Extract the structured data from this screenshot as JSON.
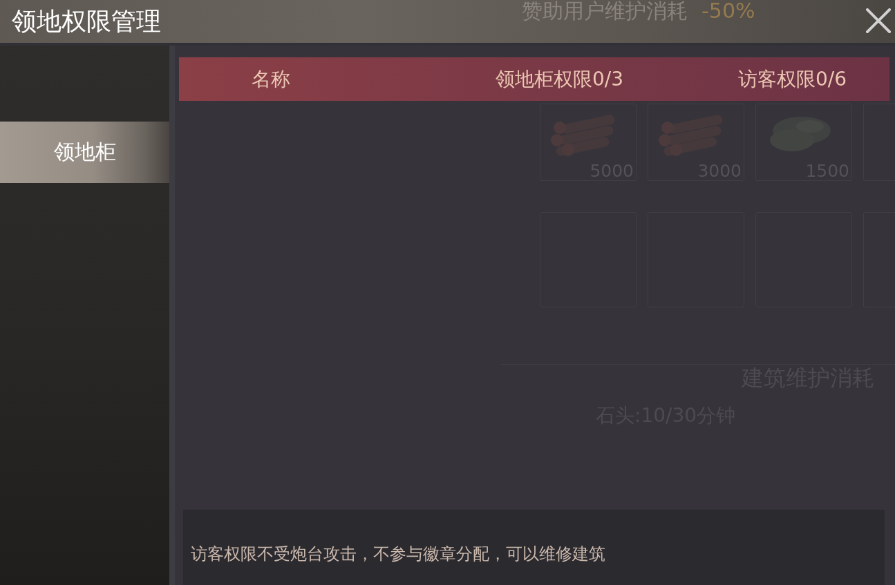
{
  "window": {
    "title": "领地权限管理"
  },
  "background": {
    "sponsor_label": "赞助用户维护消耗",
    "sponsor_value": "-50%",
    "slot_rows": [
      {
        "slots": [
          {
            "kind": "logs",
            "count": "5000"
          },
          {
            "kind": "logs",
            "count": "3000"
          },
          {
            "kind": "stone",
            "count": "1500"
          },
          {
            "kind": "empty"
          }
        ]
      },
      {
        "slots": [
          {
            "kind": "empty"
          },
          {
            "kind": "empty"
          },
          {
            "kind": "empty"
          },
          {
            "kind": "empty"
          }
        ]
      }
    ],
    "upkeep_title": "建筑维护消耗",
    "upkeep_line": "石头:10/30分钟"
  },
  "sidebar": {
    "items": [
      {
        "label": "领地柜",
        "selected": true
      }
    ]
  },
  "table": {
    "columns": [
      "名称",
      "领地柜权限0/3",
      "访客权限0/6"
    ]
  },
  "note": "访客权限不受炮台攻击，不参与徽章分配，可以维修建筑"
}
